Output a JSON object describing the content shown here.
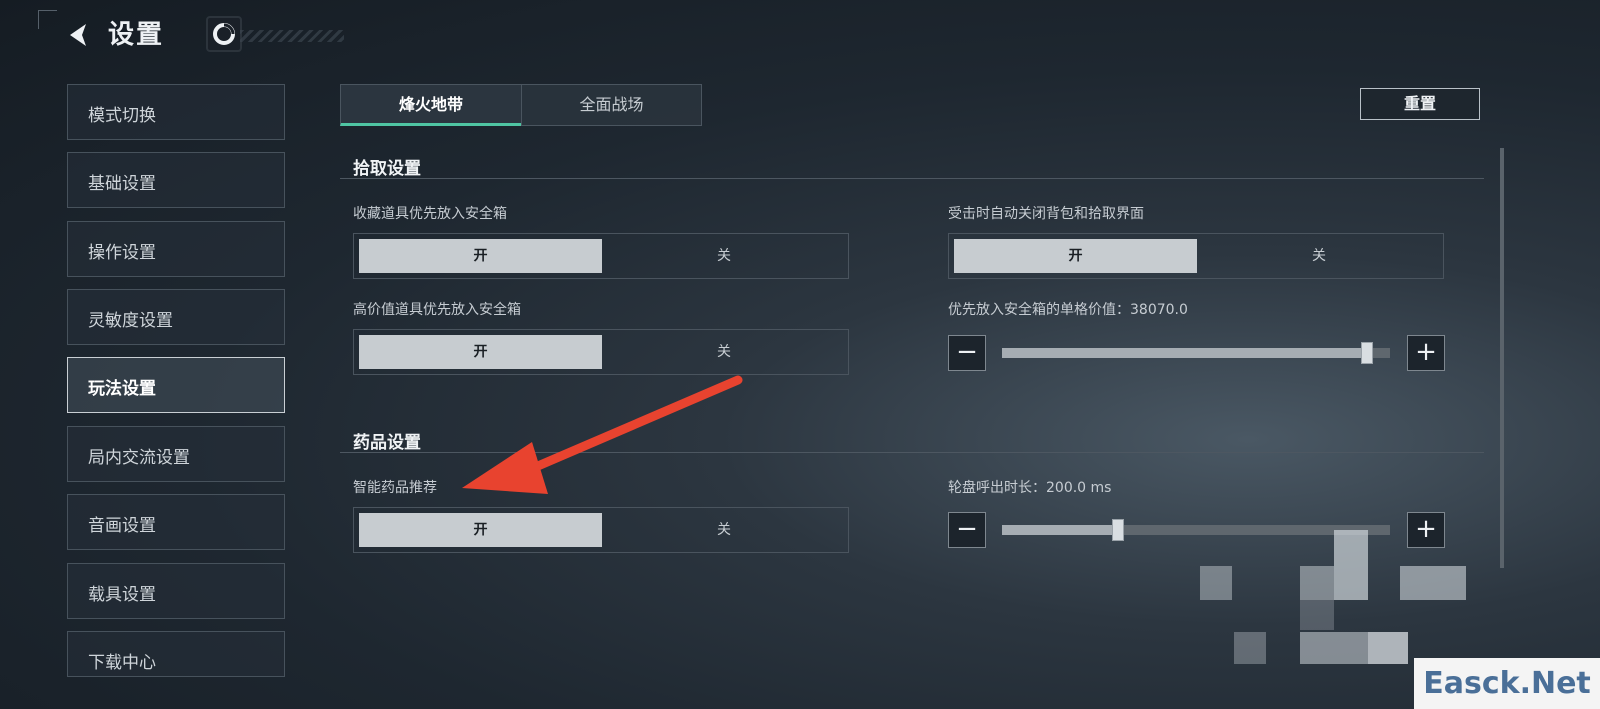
{
  "header": {
    "title": "设置",
    "back_icon": "back-arrow-icon",
    "logo_icon": "game-logo-icon"
  },
  "sidebar": {
    "items": [
      {
        "label": "模式切换"
      },
      {
        "label": "基础设置"
      },
      {
        "label": "操作设置"
      },
      {
        "label": "灵敏度设置"
      },
      {
        "label": "玩法设置",
        "active": true
      },
      {
        "label": "局内交流设置"
      },
      {
        "label": "音画设置"
      },
      {
        "label": "载具设置"
      },
      {
        "label": "下载中心"
      }
    ]
  },
  "tabs": [
    {
      "label": "烽火地带",
      "active": true
    },
    {
      "label": "全面战场"
    }
  ],
  "reset_label": "重置",
  "pickup": {
    "title": "拾取设置",
    "collect_safebox": {
      "label": "收藏道具优先放入安全箱",
      "on": "开",
      "off": "关"
    },
    "auto_close": {
      "label": "受击时自动关闭背包和拾取界面",
      "on": "开",
      "off": "关"
    },
    "high_value_safebox": {
      "label": "高价值道具优先放入安全箱",
      "on": "开",
      "off": "关"
    },
    "unit_value": {
      "label": "优先放入安全箱的单格价值：38070.0",
      "level_percent": 94
    }
  },
  "medicine": {
    "title": "药品设置",
    "smart_recommend": {
      "label": "智能药品推荐",
      "on": "开",
      "off": "关"
    },
    "wheel_duration": {
      "label": "轮盘呼出时长：200.0 ms",
      "level_percent": 30
    }
  },
  "stepper": {
    "minus": "−",
    "plus": "+"
  },
  "watermark": "Easck.Net",
  "colors": {
    "accent_tab": "#4fc5a3",
    "annotation_arrow": "#e8432f"
  }
}
